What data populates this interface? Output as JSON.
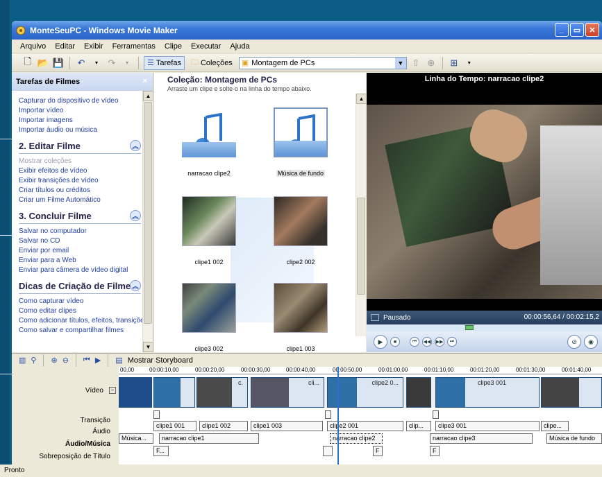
{
  "window": {
    "title": "MonteSeuPC - Windows Movie Maker",
    "minimize": "_",
    "maximize": "▭",
    "close": "✕"
  },
  "menu": [
    "Arquivo",
    "Editar",
    "Exibir",
    "Ferramentas",
    "Clipe",
    "Executar",
    "Ajuda"
  ],
  "toolbar": {
    "tasks_label": "Tarefas",
    "collections_label": "Coleções",
    "collection_combo": "Montagem de PCs"
  },
  "tasks_panel": {
    "header": "Tarefas de Filmes",
    "capture_links": [
      "Capturar do dispositivo de vídeo",
      "Importar vídeo",
      "Importar imagens",
      "Importar áudio ou música"
    ],
    "edit_title": "2. Editar Filme",
    "edit_links": [
      "Mostrar coleções",
      "Exibir efeitos de vídeo",
      "Exibir transições de vídeo",
      "Criar títulos ou créditos",
      "Criar um Filme Automático"
    ],
    "finish_title": "3. Concluir Filme",
    "finish_links": [
      "Salvar no computador",
      "Salvar no CD",
      "Enviar por email",
      "Enviar para a Web",
      "Enviar para câmera de vídeo digital"
    ],
    "tips_title": "Dicas de Criação de Filme",
    "tips_links": [
      "Como capturar vídeo",
      "Como editar clipes",
      "Como adicionar títulos, efeitos, transições",
      "Como salvar e compartilhar filmes"
    ]
  },
  "collection": {
    "title": "Coleção: Montagem de PCs",
    "subtitle": "Arraste um clipe e solte-o na linha do tempo abaixo.",
    "clips": [
      "narracao clipe2",
      "Música de fundo",
      "clipe1 002",
      "clipe2 002",
      "clipe3 002",
      "clipe1 003"
    ]
  },
  "monitor": {
    "title": "Linha do Tempo: narracao clipe2",
    "state": "Pausado",
    "time": "00:00:56,64 / 00:02:15,2"
  },
  "timeline": {
    "storyboard_label": "Mostrar Storyboard",
    "ruler": [
      "00,00",
      "00:00:10,00",
      "00:00:20,00",
      "00:00:30,00",
      "00:00:40,00",
      "00:00:50,00",
      "00:01:00,00",
      "00:01:10,00",
      "00:01:20,00",
      "00:01:30,00",
      "00:01:40,00"
    ],
    "labels": {
      "video": "Vídeo",
      "transition": "Transição",
      "audio": "Áudio",
      "music": "Áudio/Música",
      "title": "Sobreposição de Título"
    },
    "video_clips": [
      "c.",
      "cli...",
      "clipe2 0...",
      "clipe3 001"
    ],
    "audio_clips": [
      "clipe1 001",
      "clipe1 002",
      "clipe1 003",
      "clipe2 001",
      "clip...",
      "clipe3 001",
      "clipe..."
    ],
    "music_clips": [
      "Música...",
      "narracao clipe1",
      "narracao clipe2",
      "narracao clipe3",
      "Música de fundo"
    ],
    "title_clips": [
      "F...",
      "F",
      "F"
    ]
  },
  "status": "Pronto"
}
